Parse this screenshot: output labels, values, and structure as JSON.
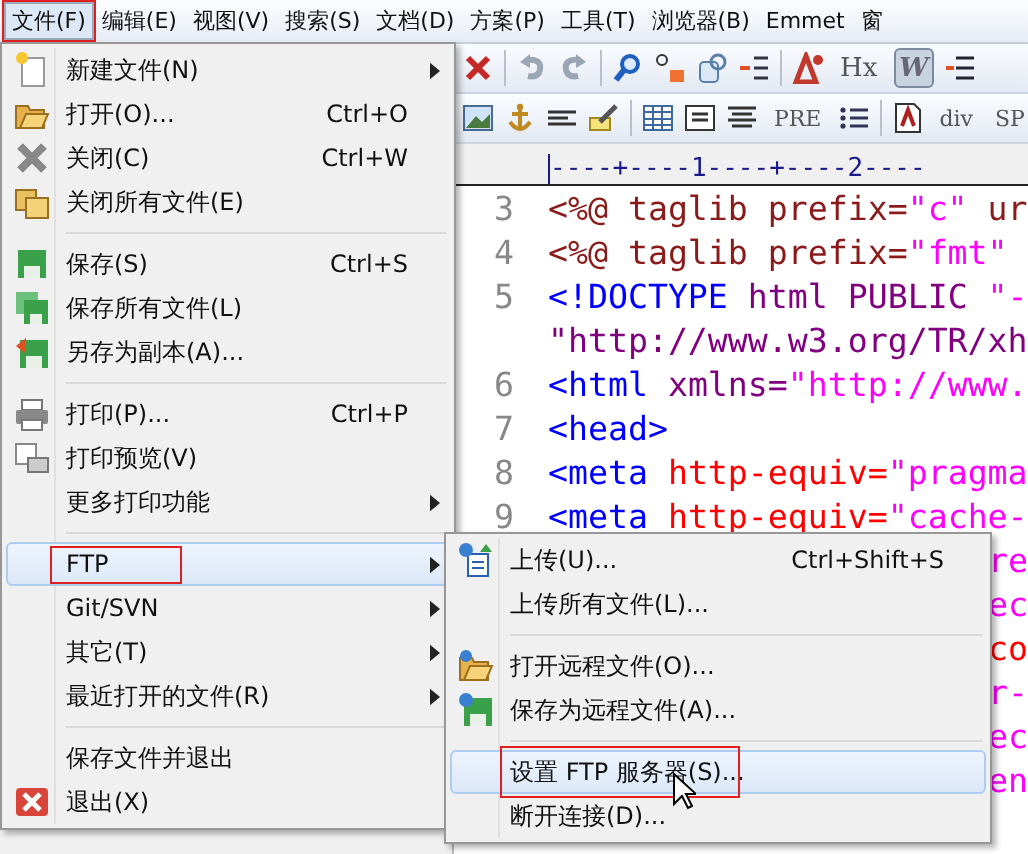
{
  "menubar": [
    {
      "label": "文件(F)",
      "selected": true,
      "annotated": true
    },
    {
      "label": "编辑(E)",
      "selected": false,
      "annotated": false
    },
    {
      "label": "视图(V)",
      "selected": false,
      "annotated": false
    },
    {
      "label": "搜索(S)",
      "selected": false,
      "annotated": false
    },
    {
      "label": "文档(D)",
      "selected": false,
      "annotated": false
    },
    {
      "label": "方案(P)",
      "selected": false,
      "annotated": false
    },
    {
      "label": "工具(T)",
      "selected": false,
      "annotated": false
    },
    {
      "label": "浏览器(B)",
      "selected": false,
      "annotated": false
    },
    {
      "label": "Emmet",
      "selected": false,
      "annotated": false
    },
    {
      "label": "窗",
      "selected": false,
      "annotated": false
    }
  ],
  "toolbars": [
    [
      {
        "label": "Hx",
        "pressed": false
      },
      {
        "label": "W",
        "pressed": true
      }
    ],
    [
      {
        "label": "PRE",
        "pressed": false
      },
      {
        "label": "div",
        "pressed": false
      },
      {
        "label": "SP",
        "pressed": false
      }
    ]
  ],
  "ruler": "----+----1----+----2----",
  "code_lines": [
    {
      "kind": "line",
      "number": "3",
      "tokens": [
        {
          "text": "<%@ taglib prefix=",
          "color": "#8b1a1a"
        },
        {
          "text": "\"c\"",
          "color": "#ff00ff"
        },
        {
          "text": " ur",
          "color": "#8b1a1a"
        }
      ]
    },
    {
      "kind": "line",
      "number": "4",
      "tokens": [
        {
          "text": "<%@ taglib prefix=",
          "color": "#8b1a1a"
        },
        {
          "text": "\"fmt\"",
          "color": "#ff00ff"
        }
      ]
    },
    {
      "kind": "line",
      "number": "5",
      "tokens": [
        {
          "text": "<!DOCTYPE",
          "color": "#0000ff"
        },
        {
          "text": " html PUBLIC ",
          "color": "#800080"
        },
        {
          "text": "\"-",
          "color": "#ff00ff"
        }
      ]
    },
    {
      "kind": "line",
      "tokens": [
        {
          "text": "\"http://www.w3.org/TR/xh",
          "color": "#800080"
        }
      ]
    },
    {
      "kind": "line",
      "number": "6",
      "tokens": [
        {
          "text": "<html ",
          "color": "#0000ff"
        },
        {
          "text": "xmlns=",
          "color": "#800080"
        },
        {
          "text": "\"http://www.",
          "color": "#ff00ff"
        }
      ]
    },
    {
      "kind": "line",
      "number": "7",
      "tokens": [
        {
          "text": "<head>",
          "color": "#0000ff"
        }
      ]
    },
    {
      "kind": "line",
      "number": "8",
      "tokens": [
        {
          "text": "<meta ",
          "color": "#0000ff"
        },
        {
          "text": "http-equiv=",
          "color": "#ff0000"
        },
        {
          "text": "\"pragma",
          "color": "#ff00ff"
        }
      ]
    },
    {
      "kind": "line",
      "number": "9",
      "tokens": [
        {
          "text": "<meta ",
          "color": "#0000ff"
        },
        {
          "text": "http-equiv=",
          "color": "#ff0000"
        },
        {
          "text": "\"cache-",
          "color": "#ff00ff"
        }
      ]
    },
    {
      "kind": "fragment",
      "tokens": [
        {
          "text": "re",
          "color": "#ff00ff"
        }
      ]
    },
    {
      "kind": "fragment",
      "tokens": [
        {
          "text": "ec",
          "color": "#ff00ff"
        }
      ]
    },
    {
      "kind": "fragment",
      "tokens": [
        {
          "text": "co",
          "color": "#ff0000"
        }
      ]
    },
    {
      "kind": "fragment",
      "tokens": [
        {
          "text": "r-",
          "color": "#ff00ff"
        }
      ]
    },
    {
      "kind": "fragment",
      "tokens": [
        {
          "text": "ec",
          "color": "#ff00ff"
        }
      ]
    },
    {
      "kind": "fragment",
      "tokens": [
        {
          "text": "en",
          "color": "#ff00ff"
        }
      ]
    }
  ],
  "file_menu": [
    {
      "kind": "item",
      "label": "新建文件(N)",
      "submenu": true,
      "selected": false,
      "annotated": false
    },
    {
      "kind": "item",
      "label": "打开(O)...",
      "shortcut": "Ctrl+O",
      "submenu": false,
      "selected": false,
      "annotated": false
    },
    {
      "kind": "item",
      "label": "关闭(C)",
      "shortcut": "Ctrl+W",
      "submenu": false,
      "selected": false,
      "annotated": false
    },
    {
      "kind": "item",
      "label": "关闭所有文件(E)",
      "submenu": false,
      "selected": false,
      "annotated": false
    },
    {
      "kind": "separator"
    },
    {
      "kind": "item",
      "label": "保存(S)",
      "shortcut": "Ctrl+S",
      "submenu": false,
      "selected": false,
      "annotated": false
    },
    {
      "kind": "item",
      "label": "保存所有文件(L)",
      "submenu": false,
      "selected": false,
      "annotated": false
    },
    {
      "kind": "item",
      "label": "另存为副本(A)...",
      "submenu": false,
      "selected": false,
      "annotated": false
    },
    {
      "kind": "separator"
    },
    {
      "kind": "item",
      "label": "打印(P)...",
      "shortcut": "Ctrl+P",
      "submenu": false,
      "selected": false,
      "annotated": false
    },
    {
      "kind": "item",
      "label": "打印预览(V)",
      "submenu": false,
      "selected": false,
      "annotated": false
    },
    {
      "kind": "item",
      "label": "更多打印功能",
      "submenu": true,
      "selected": false,
      "annotated": false
    },
    {
      "kind": "separator"
    },
    {
      "kind": "item",
      "label": "FTP",
      "submenu": true,
      "selected": true,
      "annotated": true
    },
    {
      "kind": "item",
      "label": "Git/SVN",
      "submenu": true,
      "selected": false,
      "annotated": false
    },
    {
      "kind": "item",
      "label": "其它(T)",
      "submenu": true,
      "selected": false,
      "annotated": false
    },
    {
      "kind": "item",
      "label": "最近打开的文件(R)",
      "submenu": true,
      "selected": false,
      "annotated": false
    },
    {
      "kind": "separator"
    },
    {
      "kind": "item",
      "label": "保存文件并退出",
      "submenu": false,
      "selected": false,
      "annotated": false
    },
    {
      "kind": "item",
      "label": "退出(X)",
      "submenu": false,
      "selected": false,
      "annotated": false
    }
  ],
  "ftp_menu": [
    {
      "kind": "item",
      "label": "上传(U)...",
      "shortcut": "Ctrl+Shift+S",
      "submenu": false,
      "selected": false,
      "annotated": false
    },
    {
      "kind": "item",
      "label": "上传所有文件(L)...",
      "submenu": false,
      "selected": false,
      "annotated": false
    },
    {
      "kind": "separator"
    },
    {
      "kind": "item",
      "label": "打开远程文件(O)...",
      "submenu": false,
      "selected": false,
      "annotated": false
    },
    {
      "kind": "item",
      "label": "保存为远程文件(A)...",
      "submenu": false,
      "selected": false,
      "annotated": false
    },
    {
      "kind": "separator"
    },
    {
      "kind": "item",
      "label": "设置 FTP 服务器(S)...",
      "submenu": false,
      "selected": true,
      "annotated": true
    },
    {
      "kind": "item",
      "label": "断开连接(D)...",
      "submenu": false,
      "selected": false,
      "annotated": false
    }
  ]
}
